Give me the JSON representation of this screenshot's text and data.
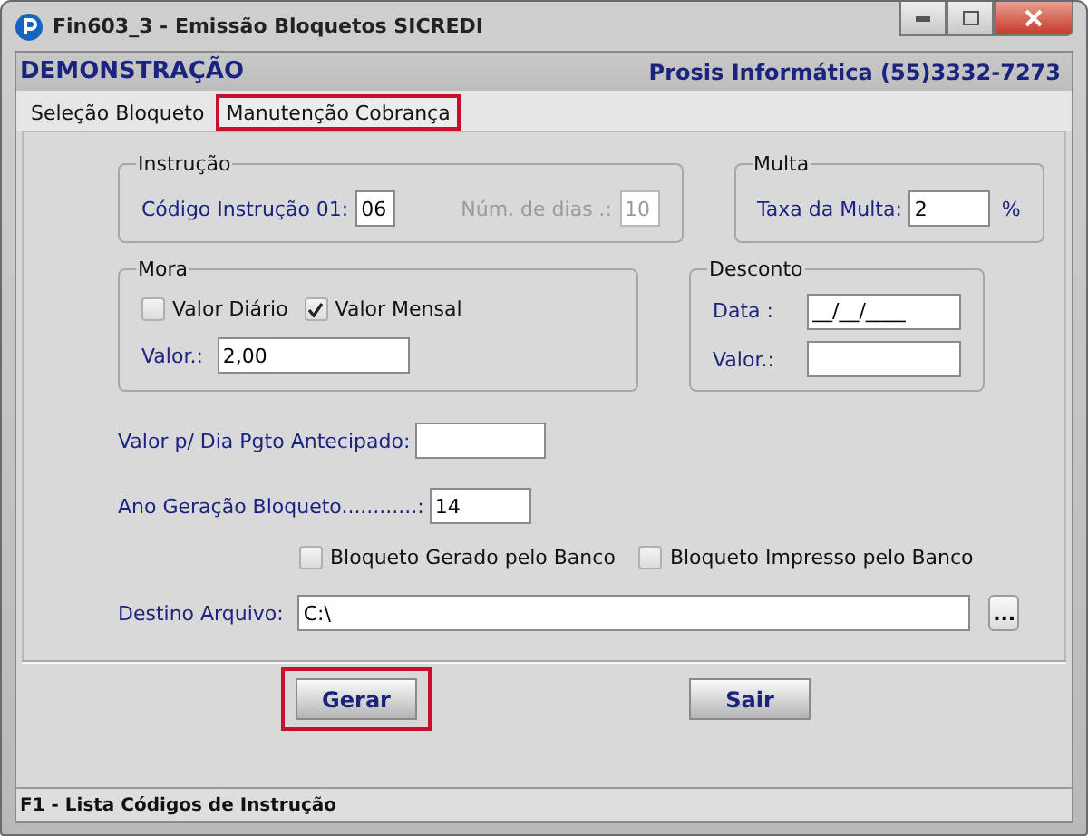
{
  "window": {
    "title": "Fin603_3 - Emissão Bloquetos SICREDI"
  },
  "header": {
    "company": "DEMONSTRAÇÃO",
    "vendor": "Prosis Informática (55)3332-7273"
  },
  "tabs": [
    {
      "label": "Seleção Bloqueto",
      "selected": false
    },
    {
      "label": "Manutenção Cobrança",
      "selected": true
    }
  ],
  "instrucao": {
    "legend": "Instrução",
    "code_label": "Código Instrução 01:",
    "code_value": "06",
    "days_label": "Núm. de dias .:",
    "days_value": "10",
    "days_disabled": true
  },
  "multa": {
    "legend": "Multa",
    "label": "Taxa da Multa:",
    "value": "2",
    "unit": "%"
  },
  "mora": {
    "legend": "Mora",
    "options": [
      {
        "label": "Valor Diário",
        "checked": false
      },
      {
        "label": "Valor Mensal",
        "checked": true
      }
    ],
    "value_label": "Valor.:",
    "value": "2,00"
  },
  "desconto": {
    "legend": "Desconto",
    "date_label": "Data :",
    "date_value": "__/__/____",
    "value_label": "Valor.:"
  },
  "antecipado": {
    "label": "Valor p/ Dia Pgto Antecipado:"
  },
  "ano": {
    "label": "Ano Geração Bloqueto............:",
    "value": "14"
  },
  "flags": [
    {
      "label": "Bloqueto Gerado pelo Banco",
      "checked": false
    },
    {
      "label": "Bloqueto Impresso pelo Banco",
      "checked": false
    }
  ],
  "destino": {
    "label": "Destino Arquivo:",
    "value": "C:\\",
    "browse": "..."
  },
  "buttons": [
    {
      "label": "Gerar",
      "highlighted": true
    },
    {
      "label": "Sair",
      "highlighted": false
    }
  ],
  "status_bar": "F1 - Lista Códigos de Instrução"
}
